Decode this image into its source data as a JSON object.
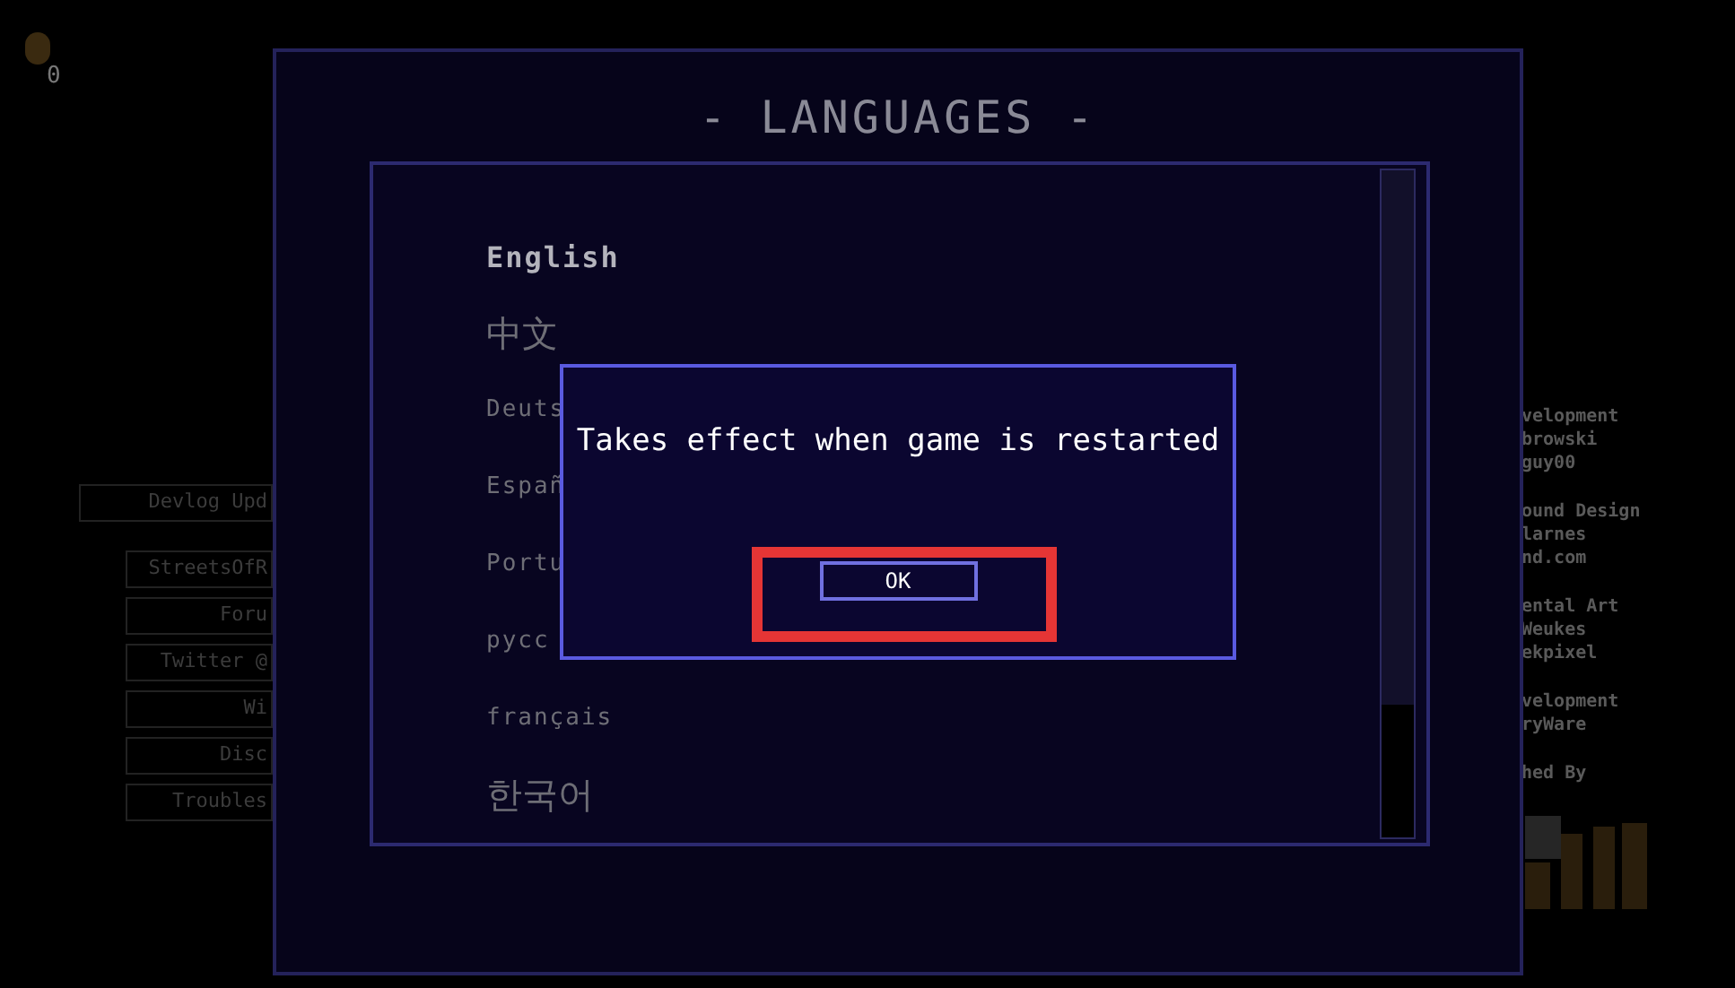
{
  "coin_counter": "0",
  "side_menu": [
    {
      "label": "Devlog Upd",
      "kind": "wide"
    },
    {
      "label": "StreetsOfR",
      "kind": "narrow"
    },
    {
      "label": "Foru",
      "kind": "narrow"
    },
    {
      "label": "Twitter @",
      "kind": "narrow"
    },
    {
      "label": "Wi",
      "kind": "narrow"
    },
    {
      "label": "Disc",
      "kind": "narrow"
    },
    {
      "label": "Troubles",
      "kind": "narrow"
    }
  ],
  "credits": [
    [
      "velopment",
      "browski",
      "guy00"
    ],
    [
      "ound Design",
      "larnes",
      "nd.com"
    ],
    [
      "ental Art",
      "Weukes",
      "ekpixel"
    ],
    [
      "velopment",
      "ryWare"
    ],
    [
      "hed By"
    ]
  ],
  "languages_panel": {
    "title": "- LANGUAGES -",
    "languages": [
      {
        "label": "English",
        "kind": "latin",
        "selected": true
      },
      {
        "label": "中文",
        "kind": "cjk",
        "selected": false
      },
      {
        "label": "Deuts",
        "kind": "latin",
        "selected": false
      },
      {
        "label": "Españ",
        "kind": "latin",
        "selected": false
      },
      {
        "label": "Portu",
        "kind": "latin",
        "selected": false
      },
      {
        "label": "русс",
        "kind": "latin",
        "selected": false
      },
      {
        "label": "français",
        "kind": "latin",
        "selected": false
      },
      {
        "label": "한국어",
        "kind": "cjk",
        "selected": false
      }
    ]
  },
  "dialog": {
    "message": "Takes effect when game is restarted",
    "button": "OK",
    "highlighted": true
  }
}
